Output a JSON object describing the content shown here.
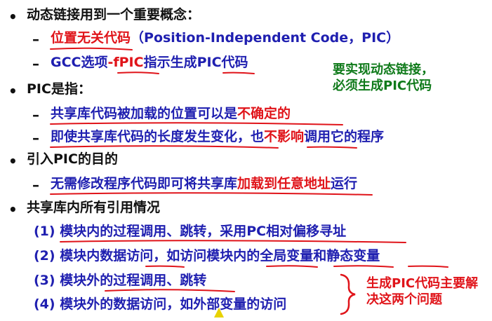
{
  "slide": {
    "b1": {
      "text": "动态链接用到一个重要概念："
    },
    "b1_s1": {
      "red_part": "位置无关代码",
      "rest": "（Position-Independent Code，PIC）"
    },
    "b1_s2": {
      "a": "GCC选项",
      "red": "-fPIC",
      "b": "指示生成PIC代码"
    },
    "note_green": {
      "line1": "要实现动态链接，",
      "line2": "必须生成PIC代码"
    },
    "b2": {
      "text": "PIC是指："
    },
    "b2_s1": {
      "a": "共享库代码被加载的位置可以是",
      "red": "不确定的"
    },
    "b2_s2": {
      "a": "即使共享库代码的长度发生变化，也",
      "red": "不影响",
      "b": "调用它的程序"
    },
    "b3": {
      "text": "引入PIC的目的"
    },
    "b3_s1": {
      "a": "无需修改程序代码即可将共享库",
      "red": "加载到任意地址",
      "b": "运行"
    },
    "b4": {
      "text": "共享库内所有引用情况"
    },
    "items": [
      "(1) 模块内的过程调用、跳转，采用PC相对偏移寻址",
      "(2) 模块内数据访问，如访问模块内的全局变量和静态变量",
      "(3) 模块外的过程调用、跳转",
      "(4) 模块外的数据访问，如外部变量的访问"
    ],
    "note_red": {
      "line1": "生成PIC代码主要解",
      "line2": "决这两个问题"
    }
  },
  "colors": {
    "blue": "#1f1fb0",
    "red": "#e0141a",
    "green": "#0f7a1a",
    "black": "#111111"
  },
  "icons": {
    "bullet": "bullet-dot",
    "dash": "en-dash",
    "cursor": "mouse-pointer-icon"
  }
}
